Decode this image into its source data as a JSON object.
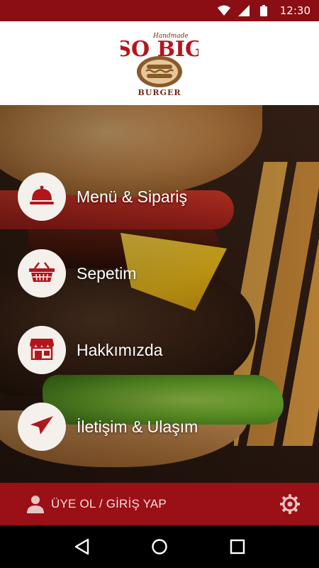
{
  "status_bar": {
    "time": "12:30",
    "icons": [
      "wifi-icon",
      "signal-icon",
      "battery-icon"
    ]
  },
  "header": {
    "logo": {
      "script_text": "Handmade",
      "brand_text": "SO BIG",
      "sub_text": "BURGER"
    }
  },
  "menu": {
    "items": [
      {
        "label": "Menü & Sipariş",
        "icon": "cloche-icon"
      },
      {
        "label": "Sepetim",
        "icon": "basket-icon"
      },
      {
        "label": "Hakkımızda",
        "icon": "store-icon"
      },
      {
        "label": "İletişim & Ulaşım",
        "icon": "paper-plane-icon"
      }
    ]
  },
  "login_bar": {
    "label": "ÜYE OL / GİRİŞ YAP",
    "icons": [
      "user-icon",
      "settings-gear-icon"
    ]
  },
  "nav_bar": {
    "icons": [
      "back-icon",
      "home-icon",
      "recents-icon"
    ]
  },
  "colors": {
    "primary": "#9b1016",
    "status_bar": "#8a0e14",
    "circle_bg": "#f4f0ec",
    "icon_color": "#b3151c"
  }
}
